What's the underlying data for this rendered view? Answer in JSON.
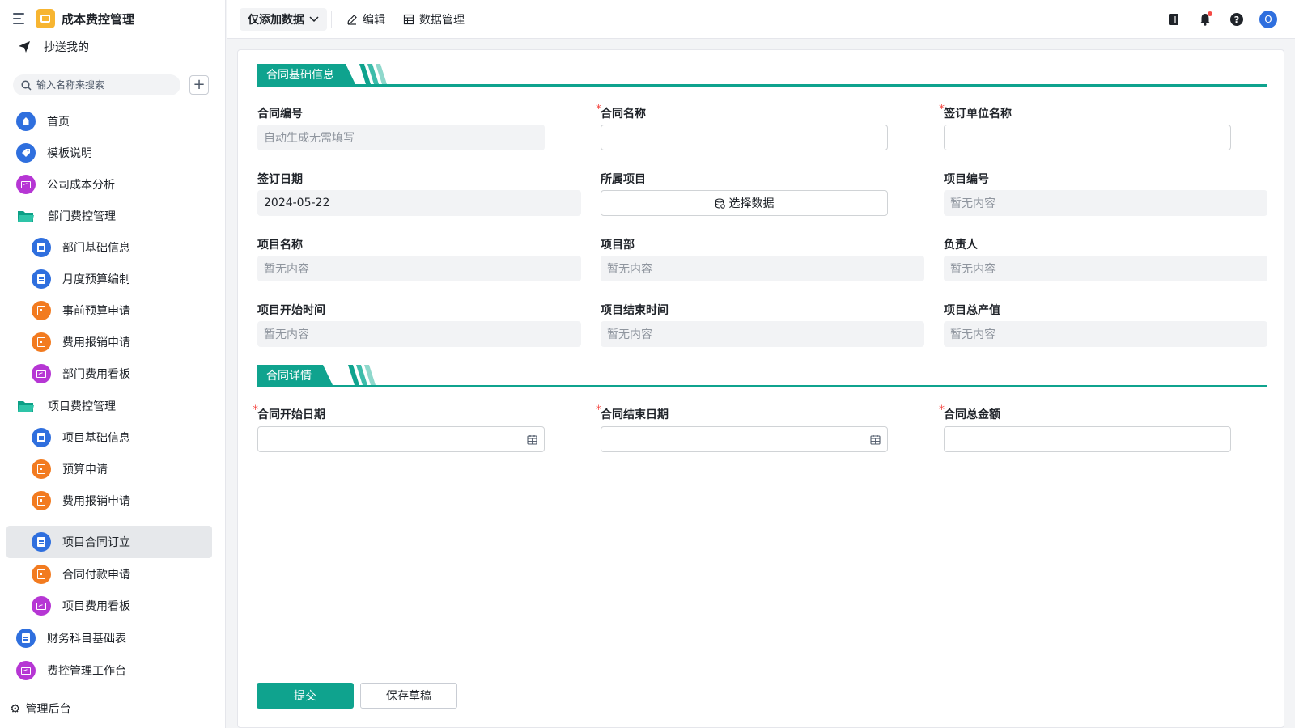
{
  "app": {
    "title": "成本费控管理",
    "cc_label": "抄送我的"
  },
  "search": {
    "placeholder": "输入名称来搜索"
  },
  "nav": [
    {
      "label": "首页",
      "icon": "home-icon"
    },
    {
      "label": "模板说明",
      "icon": "tag-icon"
    },
    {
      "label": "公司成本分析",
      "icon": "dashboard-icon"
    },
    {
      "label": "部门费控管理",
      "icon": "folder-icon"
    },
    {
      "label": "部门基础信息",
      "icon": "form-icon"
    },
    {
      "label": "月度预算编制",
      "icon": "form-icon"
    },
    {
      "label": "事前预算申请",
      "icon": "approval-icon"
    },
    {
      "label": "费用报销申请",
      "icon": "approval-icon"
    },
    {
      "label": "部门费用看板",
      "icon": "dashboard-icon"
    },
    {
      "label": "项目费控管理",
      "icon": "folder-icon"
    },
    {
      "label": "项目基础信息",
      "icon": "form-icon"
    },
    {
      "label": "预算申请",
      "icon": "approval-icon"
    },
    {
      "label": "费用报销申请",
      "icon": "approval-icon"
    },
    {
      "label": "项目合同订立",
      "icon": "form-icon"
    },
    {
      "label": "合同付款申请",
      "icon": "approval-icon"
    },
    {
      "label": "项目费用看板",
      "icon": "dashboard-icon"
    },
    {
      "label": "财务科目基础表",
      "icon": "form-icon"
    },
    {
      "label": "费控管理工作台",
      "icon": "dashboard-icon"
    }
  ],
  "admin_label": "管理后台",
  "toolbar": {
    "view": "仅添加数据",
    "edit": "编辑",
    "data_manage": "数据管理",
    "avatar": "O"
  },
  "section1": {
    "title": "合同基础信息",
    "fields": {
      "contract_no": {
        "label": "合同编号",
        "placeholder": "自动生成无需填写"
      },
      "contract_name": {
        "label": "合同名称",
        "value": ""
      },
      "sign_unit": {
        "label": "签订单位名称",
        "value": ""
      },
      "sign_date": {
        "label": "签订日期",
        "value": "2024-05-22"
      },
      "project": {
        "label": "所属项目",
        "button": "选择数据"
      },
      "project_no": {
        "label": "项目编号",
        "value": "暂无内容"
      },
      "project_name": {
        "label": "项目名称",
        "value": "暂无内容"
      },
      "project_dept": {
        "label": "项目部",
        "value": "暂无内容"
      },
      "owner": {
        "label": "负责人",
        "value": "暂无内容"
      },
      "project_start": {
        "label": "项目开始时间",
        "value": "暂无内容"
      },
      "project_end": {
        "label": "项目结束时间",
        "value": "暂无内容"
      },
      "project_output": {
        "label": "项目总产值",
        "value": "暂无内容"
      }
    }
  },
  "section2": {
    "title": "合同详情",
    "fields": {
      "contract_start": {
        "label": "合同开始日期",
        "value": ""
      },
      "contract_end": {
        "label": "合同结束日期",
        "value": ""
      },
      "contract_amount": {
        "label": "合同总金额",
        "value": ""
      }
    }
  },
  "footer": {
    "submit": "提交",
    "save_draft": "保存草稿"
  },
  "colors": {
    "accent": "#0fa38e",
    "primary_blue": "#2f6fde",
    "orange": "#f27b20",
    "purple": "#b636d4"
  }
}
